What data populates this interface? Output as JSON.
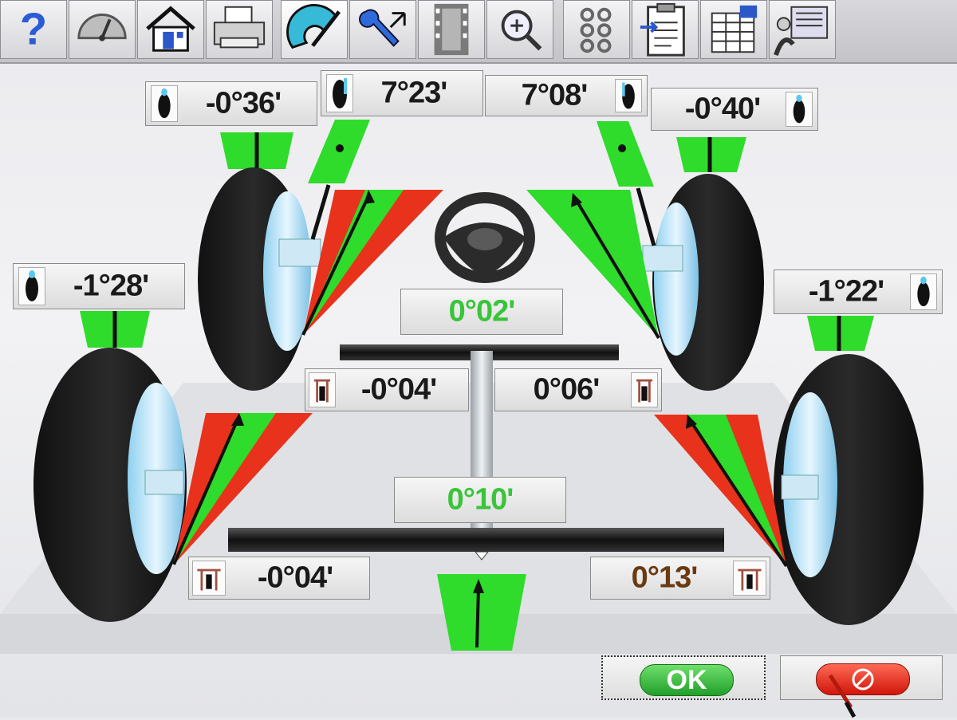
{
  "toolbar": {
    "buttons": [
      {
        "id": "help",
        "icon": "question-mark-icon"
      },
      {
        "id": "gauge",
        "icon": "gauge-icon"
      },
      {
        "id": "home",
        "icon": "home-icon"
      },
      {
        "id": "print",
        "icon": "printer-icon"
      },
      {
        "id": "measure",
        "icon": "protractor-icon"
      },
      {
        "id": "adjust",
        "icon": "wrench-icon"
      },
      {
        "id": "film",
        "icon": "film-strip-icon"
      },
      {
        "id": "zoom",
        "icon": "magnifier-icon"
      },
      {
        "id": "chain",
        "icon": "linkage-icon"
      },
      {
        "id": "clipboard",
        "icon": "clipboard-icon"
      },
      {
        "id": "spreadsheet",
        "icon": "spreadsheet-icon"
      },
      {
        "id": "technician",
        "icon": "technician-icon"
      }
    ]
  },
  "readings": {
    "front_left_camber": "-0°36'",
    "front_left_caster": "7°23'",
    "front_right_caster": "7°08'",
    "front_right_camber": "-0°40'",
    "rear_left_camber": "-1°28'",
    "rear_right_camber": "-1°22'",
    "steering_center": "0°02'",
    "front_left_toe": "-0°04'",
    "front_right_toe": "0°06'",
    "thrust_angle": "0°10'",
    "rear_left_toe": "-0°04'",
    "rear_right_toe": "0°13'"
  },
  "colors": {
    "in_spec": "#39c43a",
    "out_of_spec": "#e8321c",
    "value_brown": "#6a3a12"
  },
  "buttons": {
    "ok_label": "OK"
  }
}
